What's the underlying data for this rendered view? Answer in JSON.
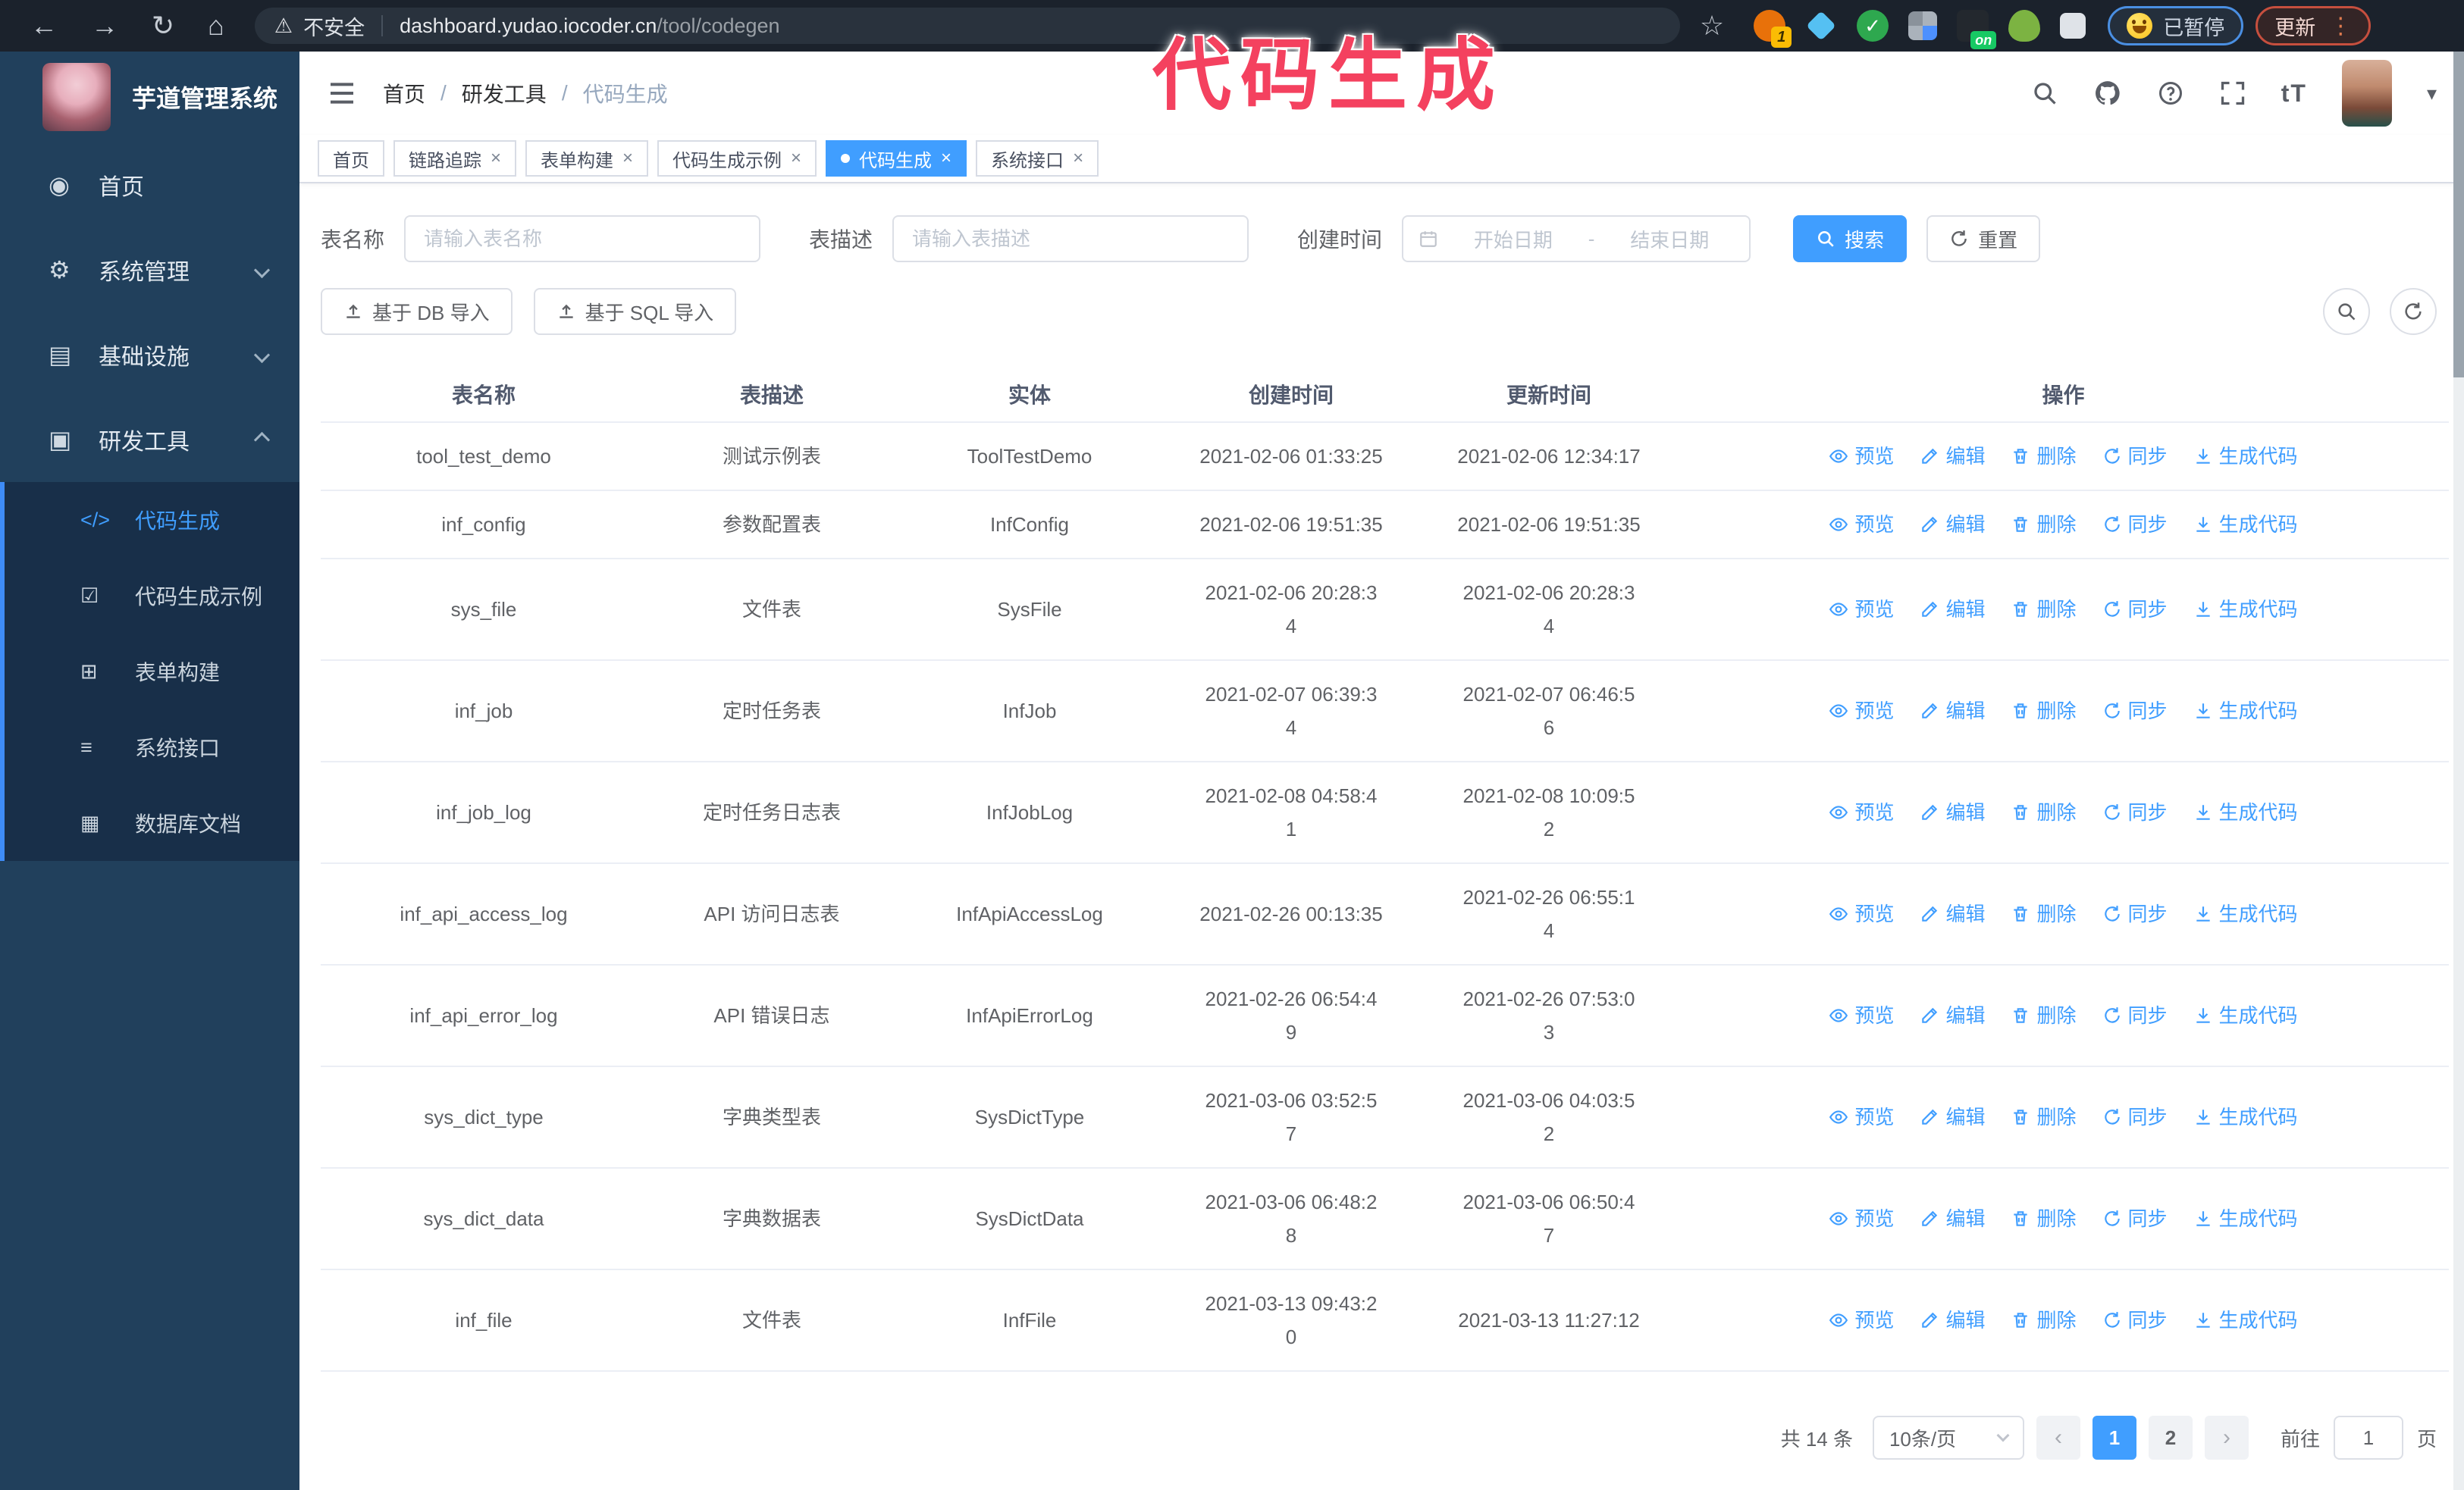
{
  "browser": {
    "security_label": "不安全",
    "url_host": "dashboard.yudao.iocoder.cn",
    "url_path": "/tool/codegen",
    "ext_badge": "1",
    "ext_on_badge": "on",
    "paused_label": "已暂停",
    "update_label": "更新"
  },
  "icons": {
    "back": "←",
    "forward": "→",
    "reload": "↻",
    "home": "⌂",
    "warning": "⚠",
    "star": "☆",
    "check": "✓",
    "dots": "⋮",
    "caret_down": "▾",
    "close": "×",
    "text_size": "tT",
    "menu_home": "◉",
    "menu_gear": "⚙",
    "menu_infra": "▤",
    "menu_tools": "▣",
    "sub_code": "</>",
    "sub_example": "☑",
    "sub_form": "⊞",
    "sub_api": "≡",
    "sub_db": "▦"
  },
  "overlay": {
    "title": "代码生成",
    "color": "#f4415f"
  },
  "sidebar": {
    "logo_title": "芋道管理系统",
    "items": [
      {
        "label": "首页"
      },
      {
        "label": "系统管理"
      },
      {
        "label": "基础设施"
      },
      {
        "label": "研发工具"
      }
    ],
    "sub_items": [
      {
        "label": "代码生成",
        "active": true
      },
      {
        "label": "代码生成示例"
      },
      {
        "label": "表单构建"
      },
      {
        "label": "系统接口"
      },
      {
        "label": "数据库文档"
      }
    ]
  },
  "header": {
    "breadcrumb": [
      "首页",
      "研发工具",
      "代码生成"
    ],
    "separator": "/"
  },
  "tags": [
    {
      "label": "首页",
      "closable": false,
      "active": false
    },
    {
      "label": "链路追踪",
      "closable": true,
      "active": false
    },
    {
      "label": "表单构建",
      "closable": true,
      "active": false
    },
    {
      "label": "代码生成示例",
      "closable": true,
      "active": false
    },
    {
      "label": "代码生成",
      "closable": true,
      "active": true
    },
    {
      "label": "系统接口",
      "closable": true,
      "active": false
    }
  ],
  "filters": {
    "name_label": "表名称",
    "name_placeholder": "请输入表名称",
    "desc_label": "表描述",
    "desc_placeholder": "请输入表描述",
    "time_label": "创建时间",
    "start_placeholder": "开始日期",
    "range_separator": "-",
    "end_placeholder": "结束日期",
    "search_label": "搜索",
    "reset_label": "重置"
  },
  "toolbar": {
    "import_db_label": "基于 DB 导入",
    "import_sql_label": "基于 SQL 导入"
  },
  "table": {
    "columns": [
      "表名称",
      "表描述",
      "实体",
      "创建时间",
      "更新时间",
      "操作"
    ],
    "row_actions": [
      "预览",
      "编辑",
      "删除",
      "同步",
      "生成代码"
    ],
    "rows": [
      {
        "name": "tool_test_demo",
        "desc": "测试示例表",
        "entity": "ToolTestDemo",
        "created": "2021-02-06 01:33:25",
        "updated": "2021-02-06 12:34:17"
      },
      {
        "name": "inf_config",
        "desc": "参数配置表",
        "entity": "InfConfig",
        "created": "2021-02-06 19:51:35",
        "updated": "2021-02-06 19:51:35"
      },
      {
        "name": "sys_file",
        "desc": "文件表",
        "entity": "SysFile",
        "created": [
          "2021-02-06 20:28:3",
          "4"
        ],
        "updated": [
          "2021-02-06 20:28:3",
          "4"
        ]
      },
      {
        "name": "inf_job",
        "desc": "定时任务表",
        "entity": "InfJob",
        "created": [
          "2021-02-07 06:39:3",
          "4"
        ],
        "updated": [
          "2021-02-07 06:46:5",
          "6"
        ]
      },
      {
        "name": "inf_job_log",
        "desc": "定时任务日志表",
        "entity": "InfJobLog",
        "created": [
          "2021-02-08 04:58:4",
          "1"
        ],
        "updated": [
          "2021-02-08 10:09:5",
          "2"
        ]
      },
      {
        "name": "inf_api_access_log",
        "desc": "API 访问日志表",
        "entity": "InfApiAccessLog",
        "created": "2021-02-26 00:13:35",
        "updated": [
          "2021-02-26 06:55:1",
          "4"
        ]
      },
      {
        "name": "inf_api_error_log",
        "desc": "API 错误日志",
        "entity": "InfApiErrorLog",
        "created": [
          "2021-02-26 06:54:4",
          "9"
        ],
        "updated": [
          "2021-02-26 07:53:0",
          "3"
        ]
      },
      {
        "name": "sys_dict_type",
        "desc": "字典类型表",
        "entity": "SysDictType",
        "created": [
          "2021-03-06 03:52:5",
          "7"
        ],
        "updated": [
          "2021-03-06 04:03:5",
          "2"
        ]
      },
      {
        "name": "sys_dict_data",
        "desc": "字典数据表",
        "entity": "SysDictData",
        "created": [
          "2021-03-06 06:48:2",
          "8"
        ],
        "updated": [
          "2021-03-06 06:50:4",
          "7"
        ]
      },
      {
        "name": "inf_file",
        "desc": "文件表",
        "entity": "InfFile",
        "created": [
          "2021-03-13 09:43:2",
          "0"
        ],
        "updated": "2021-03-13 11:27:12"
      }
    ]
  },
  "pagination": {
    "total_label": "共 14 条",
    "page_size": "10条/页",
    "pages": [
      "1",
      "2"
    ],
    "active_page": "1",
    "goto_label": "前往",
    "goto_value": "1",
    "page_unit": "页"
  }
}
